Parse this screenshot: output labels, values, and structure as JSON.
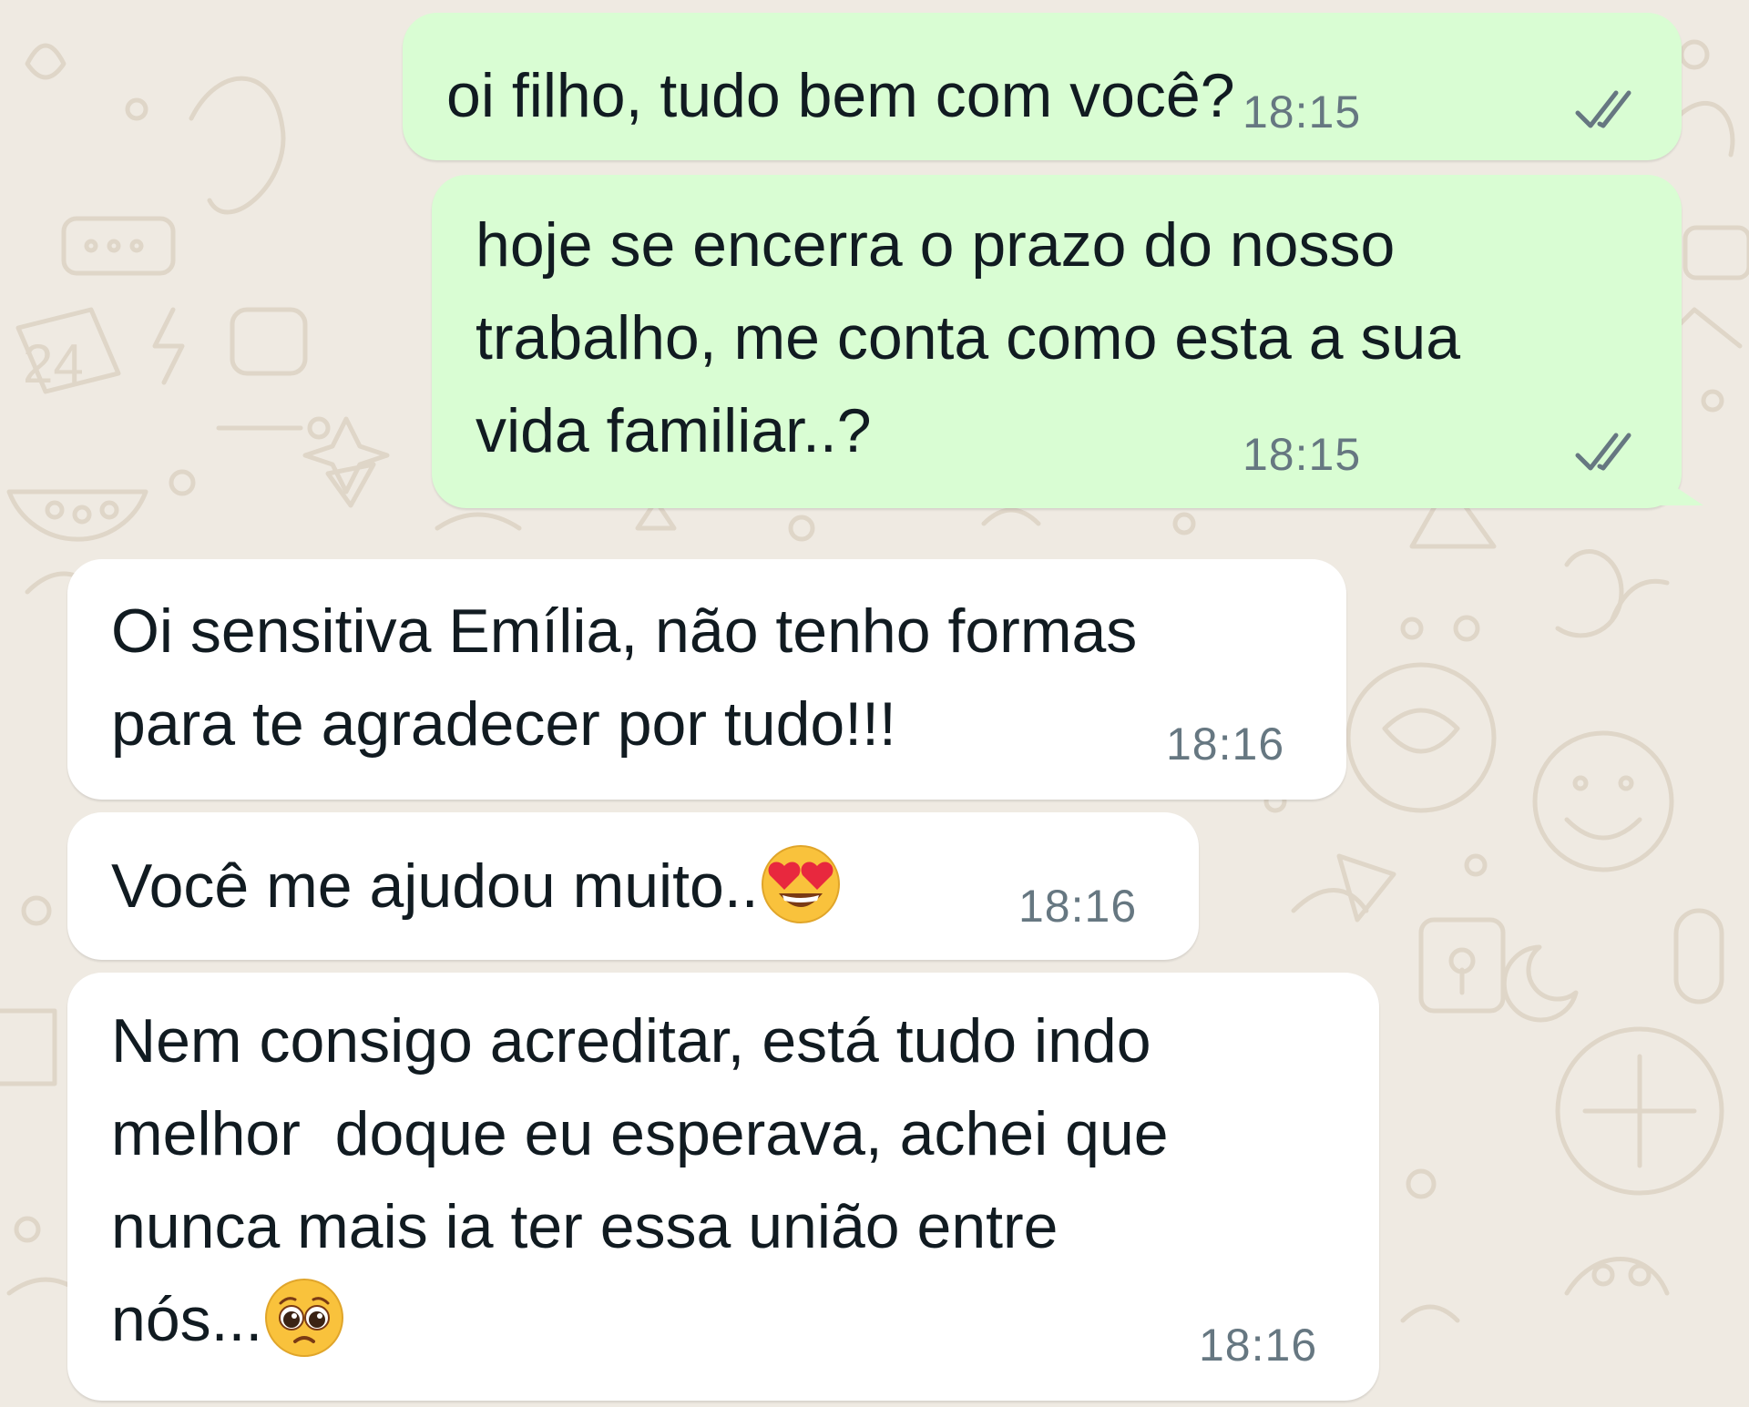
{
  "colors": {
    "wallpaper": "#efeae2",
    "outgoing_bubble": "#d9fdd3",
    "incoming_bubble": "#ffffff",
    "text": "#111b21",
    "timestamp": "#667781",
    "read_ticks": "#667781"
  },
  "messages": [
    {
      "direction": "outgoing",
      "lines": [
        "oi filho, tudo bem com você?"
      ],
      "time": "18:15",
      "status_icon": "double-check-icon"
    },
    {
      "direction": "outgoing",
      "lines": [
        "hoje se encerra o prazo do nosso",
        "trabalho, me conta como esta a sua",
        "vida familiar..?"
      ],
      "time": "18:15",
      "status_icon": "double-check-icon"
    },
    {
      "direction": "incoming",
      "lines": [
        "Oi sensitiva Emília, não tenho formas",
        "para te agradecer por tudo!!!"
      ],
      "time": "18:16"
    },
    {
      "direction": "incoming",
      "lines": [
        "Você me ajudou muito.."
      ],
      "emoji": "heart-eyes-emoji",
      "time": "18:16"
    },
    {
      "direction": "incoming",
      "lines": [
        "Nem consigo acreditar, está tudo indo",
        "melhor  doque eu esperava, achei que",
        "nunca mais ia ter essa união entre",
        "nós..."
      ],
      "emoji": "pleading-face-emoji",
      "time": "18:16"
    }
  ]
}
